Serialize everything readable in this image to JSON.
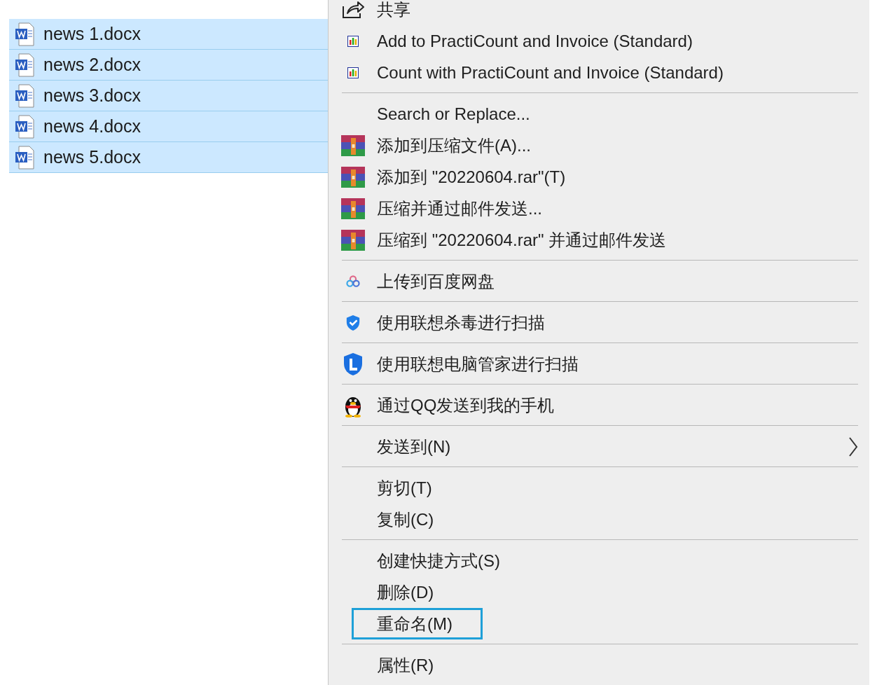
{
  "files": [
    {
      "name": "news 1.docx",
      "selected": true
    },
    {
      "name": "news 2.docx",
      "selected": true
    },
    {
      "name": "news 3.docx",
      "selected": true
    },
    {
      "name": "news 4.docx",
      "selected": true
    },
    {
      "name": "news 5.docx",
      "selected": true
    }
  ],
  "context_menu": {
    "groups": [
      [
        {
          "kind": "share",
          "label": "共享"
        },
        {
          "kind": "practicount",
          "label": "Add to PractiCount and Invoice (Standard)"
        },
        {
          "kind": "practicount",
          "label": "Count with PractiCount and Invoice (Standard)"
        }
      ],
      [
        {
          "kind": "plain",
          "label": "Search or Replace..."
        },
        {
          "kind": "archive",
          "label": "添加到压缩文件(A)..."
        },
        {
          "kind": "archive",
          "label": "添加到 \"20220604.rar\"(T)"
        },
        {
          "kind": "archive",
          "label": "压缩并通过邮件发送..."
        },
        {
          "kind": "archive",
          "label": "压缩到 \"20220604.rar\" 并通过邮件发送"
        }
      ],
      [
        {
          "kind": "cloud",
          "label": "上传到百度网盘"
        }
      ],
      [
        {
          "kind": "shield",
          "label": "使用联想杀毒进行扫描"
        }
      ],
      [
        {
          "kind": "guard",
          "label": "使用联想电脑管家进行扫描"
        }
      ],
      [
        {
          "kind": "penguin",
          "label": "通过QQ发送到我的手机"
        }
      ],
      [
        {
          "kind": "plain",
          "label": "发送到(N)",
          "submenu": true
        }
      ],
      [
        {
          "kind": "plain",
          "label": "剪切(T)"
        },
        {
          "kind": "plain",
          "label": "复制(C)"
        }
      ],
      [
        {
          "kind": "plain",
          "label": "创建快捷方式(S)"
        },
        {
          "kind": "plain",
          "label": "删除(D)"
        },
        {
          "kind": "plain",
          "label": "重命名(M)",
          "highlighted": true
        }
      ],
      [
        {
          "kind": "plain",
          "label": "属性(R)"
        }
      ]
    ]
  }
}
